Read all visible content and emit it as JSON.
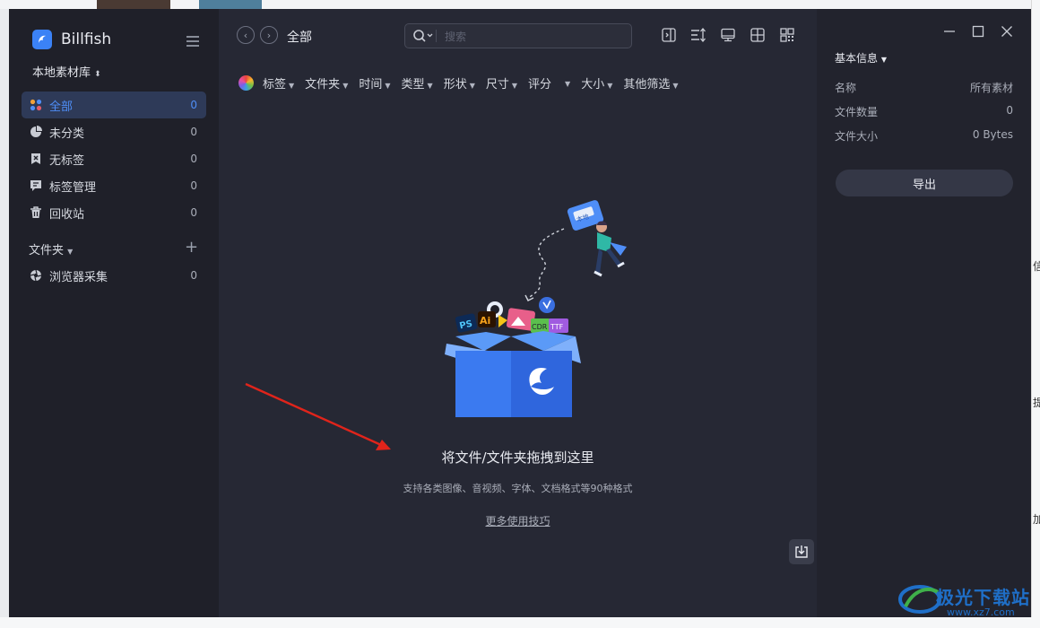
{
  "app": {
    "name": "Billfish",
    "library": "本地素材库"
  },
  "sidebar": {
    "items": [
      {
        "label": "全部",
        "count": "0"
      },
      {
        "label": "未分类",
        "count": "0"
      },
      {
        "label": "无标签",
        "count": "0"
      },
      {
        "label": "标签管理",
        "count": "0"
      },
      {
        "label": "回收站",
        "count": "0"
      }
    ],
    "folder_header": "文件夹",
    "folder_add": "+",
    "folders": [
      {
        "label": "浏览器采集",
        "count": "0"
      }
    ]
  },
  "header": {
    "breadcrumb": "全部",
    "search_placeholder": "搜索"
  },
  "filters": [
    "标签",
    "文件夹",
    "时间",
    "类型",
    "形状",
    "尺寸",
    "评分",
    "",
    "大小",
    "其他筛选"
  ],
  "empty": {
    "title": "将文件/文件夹拖拽到这里",
    "subtitle": "支持各类图像、音视频、字体、文档格式等90种格式",
    "tips": "更多使用技巧",
    "illus_tag": "本地",
    "badges": [
      "PS",
      "Ai",
      "CDR",
      "TTF"
    ]
  },
  "panel": {
    "header": "基本信息",
    "rows": [
      {
        "label": "名称",
        "value": "所有素材"
      },
      {
        "label": "文件数量",
        "value": "0"
      },
      {
        "label": "文件大小",
        "value": "0 Bytes"
      }
    ],
    "export_label": "导出"
  },
  "background": {
    "right_chars": [
      "信",
      "提",
      "加"
    ],
    "watermark": "极光下载站",
    "watermark_url": "www.xz7.com"
  },
  "colors": {
    "accent": "#4f8ef7",
    "sidebar_bg": "#1f2029",
    "main_bg": "#262834",
    "panel_bg": "#22232d"
  }
}
